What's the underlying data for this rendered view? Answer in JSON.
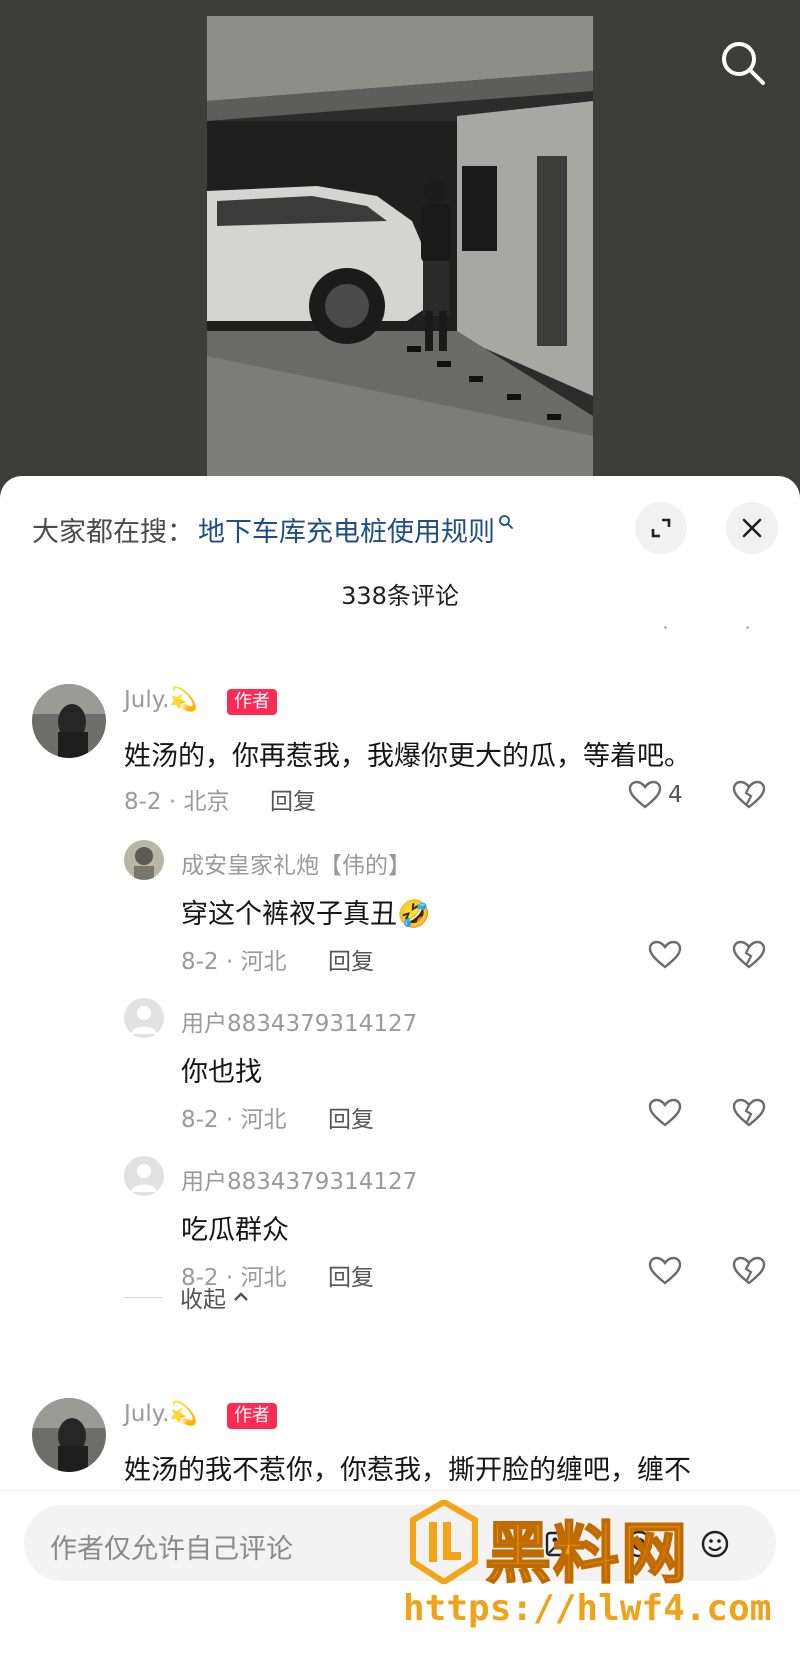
{
  "colors": {
    "accent": "#fe2c55",
    "link": "#1f4f86",
    "background": "#3d3e3c",
    "watermark": "#f4a416"
  },
  "header": {
    "search_icon": "search-icon",
    "trend_prefix": "大家都在搜：",
    "trend_query": "地下车库充电桩使用规则",
    "expand_icon": "expand-icon",
    "close_icon": "close-icon",
    "comment_count": "338条评论"
  },
  "comments": [
    {
      "user": "July.💫",
      "tag": "作者",
      "text": "姓汤的，你再惹我，我爆你更大的瓜，等着吧。",
      "meta": "8-2 · 北京",
      "reply_label": "回复",
      "likes": "4",
      "replies": [
        {
          "user": "成安皇家礼炮【伟的】",
          "text": "穿这个裤衩子真丑🤣",
          "meta": "8-2 · 河北",
          "reply_label": "回复"
        },
        {
          "user": "用户8834379314127",
          "text": "你也找",
          "meta": "8-2 · 河北",
          "reply_label": "回复"
        },
        {
          "user": "用户8834379314127",
          "text": "吃瓜群众",
          "meta": "8-2 · 河北",
          "reply_label": "回复"
        }
      ],
      "collapse_label": "收起"
    },
    {
      "user": "July.💫",
      "tag": "作者",
      "text": "姓汤的我不惹你，你惹我，撕开脸的缠吧，缠不"
    }
  ],
  "input": {
    "placeholder": "作者仅允许自己评论"
  },
  "watermark": {
    "title": "黑料网",
    "url": "https://hlwf4.com"
  }
}
